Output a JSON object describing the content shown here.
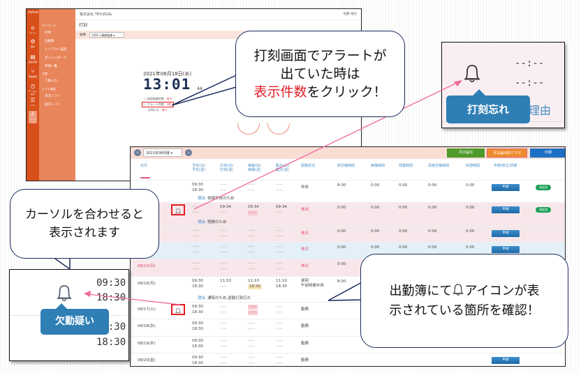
{
  "screen1": {
    "logo": "AKASHI",
    "top_company": "株式会社 TRYLEGAL",
    "user_name": "佐藤 裕也",
    "page_title": "打刻",
    "filter_label": "組織",
    "filter_value": "1091人事総務課",
    "sidebar_icons": [
      {
        "icon": "home-icon",
        "label": "ホーム"
      },
      {
        "icon": "gear-icon",
        "label": "設定"
      },
      {
        "icon": "clipboard-icon",
        "label": "勤怠管理"
      },
      {
        "icon": "branch-icon",
        "label": "申請承認"
      },
      {
        "icon": "clock-icon",
        "label": "データ入出力"
      },
      {
        "icon": "list-icon",
        "label": "シフト"
      },
      {
        "icon": "user-icon",
        "label": "マイページ"
      }
    ],
    "menu": [
      {
        "type": "section",
        "label": "マイページ"
      },
      {
        "type": "item",
        "label": "打刻"
      },
      {
        "type": "item",
        "label": "出勤簿"
      },
      {
        "type": "item",
        "label": "レイアウト設定"
      },
      {
        "type": "item",
        "label": "ダッシュボード"
      },
      {
        "type": "item",
        "label": "申請一覧"
      },
      {
        "type": "section",
        "label": "工数"
      },
      {
        "type": "item",
        "label": "工数入力"
      },
      {
        "type": "section",
        "label": "シフト確認"
      },
      {
        "type": "item",
        "label": "月次シフト"
      },
      {
        "type": "item",
        "label": "週次シフト"
      }
    ],
    "date": "2021年08月18日(水)",
    "time": "13:01",
    "seconds": "44",
    "alerts": [
      {
        "label": "承認依頼件数",
        "value": "有り"
      },
      {
        "label": "アラート件数",
        "value": "3件"
      },
      {
        "label": "お知らせ",
        "value": "有り"
      }
    ]
  },
  "zoom_alert": {
    "time1": "--:--",
    "time2": "--:--",
    "tooltip": "打刻忘れ",
    "reason_partial": "理由"
  },
  "screen2": {
    "month": "2021年08月度",
    "buttons": [
      {
        "label": "月次届出",
        "color": "#4d9a2a"
      },
      {
        "label": "月次届出取り下げ",
        "color": "#ef8b2c"
      },
      {
        "label": "印刷",
        "color": "#1d6fc4"
      }
    ],
    "headers": [
      "日付",
      "予定(出)\n予定(退)",
      "打刻(出)\n打刻(退)",
      "実績(出)\n実績(退)",
      "集計(出)\n集計(退)",
      "勤務状況",
      "総労働時間",
      "実働時間",
      "残業時間",
      "深夜労働時間",
      "休憩時間",
      "申請/修正/詳細"
    ],
    "rows": [
      {
        "date": "",
        "bell": false,
        "plan": [
          "09:30",
          "18:30"
        ],
        "punch": [
          "--:--",
          "--:--"
        ],
        "actual": [
          "--:--",
          "--:--"
        ],
        "total": [
          "--:--",
          "--:--"
        ],
        "status": "年休",
        "hours": [
          "8:00",
          "0:00",
          "0:00",
          "0:00",
          "0:00"
        ],
        "apply": "申請",
        "badge": "承認済",
        "reason": "体調不良のため",
        "bg": "white"
      },
      {
        "date": "",
        "bell": true,
        "plan": [
          "--:--",
          "--:--"
        ],
        "punch": [
          "09:34",
          "--:--"
        ],
        "actual": [
          "09:34",
          "--:--"
        ],
        "total": [
          "09:34",
          "--:--"
        ],
        "status": "休出",
        "hours": [
          "0:00",
          "0:00",
          "0:00",
          "0:00",
          "0:00"
        ],
        "apply": "申請",
        "badge": "承認済",
        "reason": "残務のため",
        "bg": "pink"
      },
      {
        "date": "",
        "bell": false,
        "plan": [
          "--:--",
          "--:--"
        ],
        "punch": [
          "--:--",
          "--:--"
        ],
        "actual": [
          "--:--",
          "--:--"
        ],
        "total": [
          "--:--",
          "--:--"
        ],
        "status": "休日",
        "hours": [
          "0:00",
          "0:00",
          "0:00",
          "0:00",
          "0:00"
        ],
        "apply": "申請",
        "badge": "",
        "reason": "",
        "bg": "pink"
      },
      {
        "date": "",
        "bell": false,
        "plan": [
          "--:--",
          "--:--"
        ],
        "punch": [
          "--:--",
          "--:--"
        ],
        "actual": [
          "--:--",
          "--:--"
        ],
        "total": [
          "--:--",
          "--:--"
        ],
        "status": "休日",
        "hours": [
          "0:00",
          "0:00",
          "0:00",
          "0:00",
          "0:00"
        ],
        "apply": "申請",
        "badge": "",
        "reason": "",
        "bg": "blue"
      },
      {
        "date": "08/15(日)",
        "bell": false,
        "plan": [
          "--:--",
          "--:--"
        ],
        "punch": [
          "--:--",
          "--:--"
        ],
        "actual": [
          "--:--",
          "--:--"
        ],
        "total": [
          "--:--",
          "--:--"
        ],
        "status": "休日",
        "hours": [
          "0:00",
          "",
          "",
          "",
          ""
        ],
        "apply": "",
        "badge": "",
        "reason": "",
        "bg": "pink"
      },
      {
        "date": "08/16(月)",
        "bell": false,
        "plan": [
          "09:30",
          "18:30"
        ],
        "punch": [
          "11:10",
          "--:--"
        ],
        "actual": [
          "11:10",
          "18:30"
        ],
        "total": [
          "11:10",
          "18:30"
        ],
        "status": "遅刻\n午前時間半休",
        "hours": [
          "8:00",
          "",
          "",
          "",
          ""
        ],
        "apply": "",
        "badge": "",
        "reason": "通院のため,退勤打刻忘れ",
        "bg": "white"
      },
      {
        "date": "08/17(火)",
        "bell": true,
        "plan": [
          "09:30",
          "18:30"
        ],
        "punch": [
          "--:--",
          "--:--"
        ],
        "actual": [
          "--:--",
          "--:--"
        ],
        "total": [
          "--:--",
          "--:--"
        ],
        "status": "勤務",
        "hours": [
          "",
          "",
          "",
          "",
          ""
        ],
        "apply": "",
        "badge": "",
        "reason": "",
        "bg": "white"
      },
      {
        "date": "08/18(水)",
        "bell": false,
        "plan": [
          "09:30",
          "18:30"
        ],
        "punch": [
          "--:--",
          "--:--"
        ],
        "actual": [
          "--:--",
          "--:--"
        ],
        "total": [
          "--:--",
          "--:--"
        ],
        "status": "勤務",
        "hours": [
          "",
          "",
          "",
          "",
          ""
        ],
        "apply": "",
        "badge": "",
        "reason": "",
        "bg": "white"
      },
      {
        "date": "08/19(木)",
        "bell": false,
        "plan": [
          "09:30",
          "18:30"
        ],
        "punch": [
          "--:--",
          "--:--"
        ],
        "actual": [
          "--:--",
          "--:--"
        ],
        "total": [
          "--:--",
          "--:--"
        ],
        "status": "勤務",
        "hours": [
          "",
          "",
          "",
          "",
          ""
        ],
        "apply": "",
        "badge": "",
        "reason": "",
        "bg": "white"
      },
      {
        "date": "08/20(金)",
        "bell": false,
        "plan": [
          "09:30",
          "18:30"
        ],
        "punch": [
          "--:--",
          "--:--"
        ],
        "actual": [
          "--:--",
          "--:--"
        ],
        "total": [
          "--:--",
          "--:--"
        ],
        "status": "勤務",
        "hours": [
          "",
          "",
          "",
          "",
          ""
        ],
        "apply": "申請",
        "badge": "",
        "reason": "",
        "bg": "white"
      }
    ],
    "reason_label": "理由"
  },
  "zoom_absence": {
    "times": [
      "09:30",
      "18:30",
      "09:30",
      "18:30"
    ],
    "tooltip": "欠勤疑い"
  },
  "callouts": {
    "top_line1": "打刻画面でアラートが",
    "top_line2": "出ていた時は",
    "top_em": "表示件数",
    "top_line3_rest": "をクリック！",
    "left_line1": "カーソルを合わせると",
    "left_line2": "表示されます",
    "right_line1_a": "出勤簿にて",
    "right_line1_b": "アイコンが表",
    "right_line2": "示されている箇所を確認！"
  }
}
